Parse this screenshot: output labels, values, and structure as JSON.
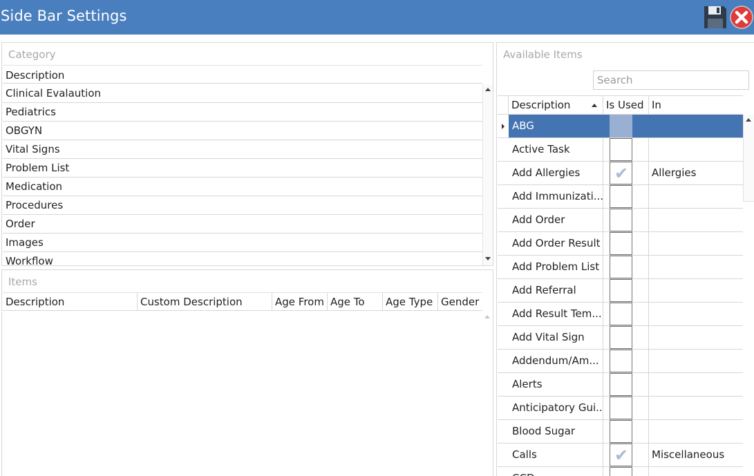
{
  "window": {
    "title": "Side Bar Settings"
  },
  "toolbar": {
    "save_icon": "floppy-disk-icon",
    "close_icon": "close-icon",
    "close_color": "#e03a3a"
  },
  "category": {
    "title": "Category",
    "header": "Description",
    "rows": [
      "Clinical Evalaution",
      "Pediatrics",
      "OBGYN",
      "Vital Signs",
      "Problem List",
      "Medication",
      "Procedures",
      "Order",
      "Images",
      "Workflow"
    ]
  },
  "items": {
    "title": "Items",
    "columns": [
      "Description",
      "Custom Description",
      "Age From",
      "Age To",
      "Age Type",
      "Gender"
    ]
  },
  "available": {
    "title": "Available Items",
    "search_placeholder": "Search",
    "columns": {
      "description": "Description",
      "is_used": "Is Used",
      "in": "In"
    },
    "rows": [
      {
        "description": "ABG",
        "is_used": false,
        "in": "",
        "selected": true
      },
      {
        "description": "Active Task",
        "is_used": false,
        "in": ""
      },
      {
        "description": "Add Allergies",
        "is_used": true,
        "in": "Allergies"
      },
      {
        "description": "Add Immunizati...",
        "is_used": false,
        "in": ""
      },
      {
        "description": "Add Order",
        "is_used": false,
        "in": ""
      },
      {
        "description": "Add Order Result",
        "is_used": false,
        "in": ""
      },
      {
        "description": "Add Problem List",
        "is_used": false,
        "in": ""
      },
      {
        "description": "Add Referral",
        "is_used": false,
        "in": ""
      },
      {
        "description": "Add Result Tem...",
        "is_used": false,
        "in": ""
      },
      {
        "description": "Add Vital Sign",
        "is_used": false,
        "in": ""
      },
      {
        "description": "Addendum/Am...",
        "is_used": false,
        "in": ""
      },
      {
        "description": "Alerts",
        "is_used": false,
        "in": ""
      },
      {
        "description": "Anticipatory Gui...",
        "is_used": false,
        "in": ""
      },
      {
        "description": "Blood Sugar",
        "is_used": false,
        "in": ""
      },
      {
        "description": "Calls",
        "is_used": true,
        "in": "Miscellaneous"
      },
      {
        "description": "CCD",
        "is_used": false,
        "in": ""
      }
    ]
  },
  "colors": {
    "titlebar": "#4a7fbf",
    "selection": "#4574b3",
    "check": "#a9bbd6"
  }
}
